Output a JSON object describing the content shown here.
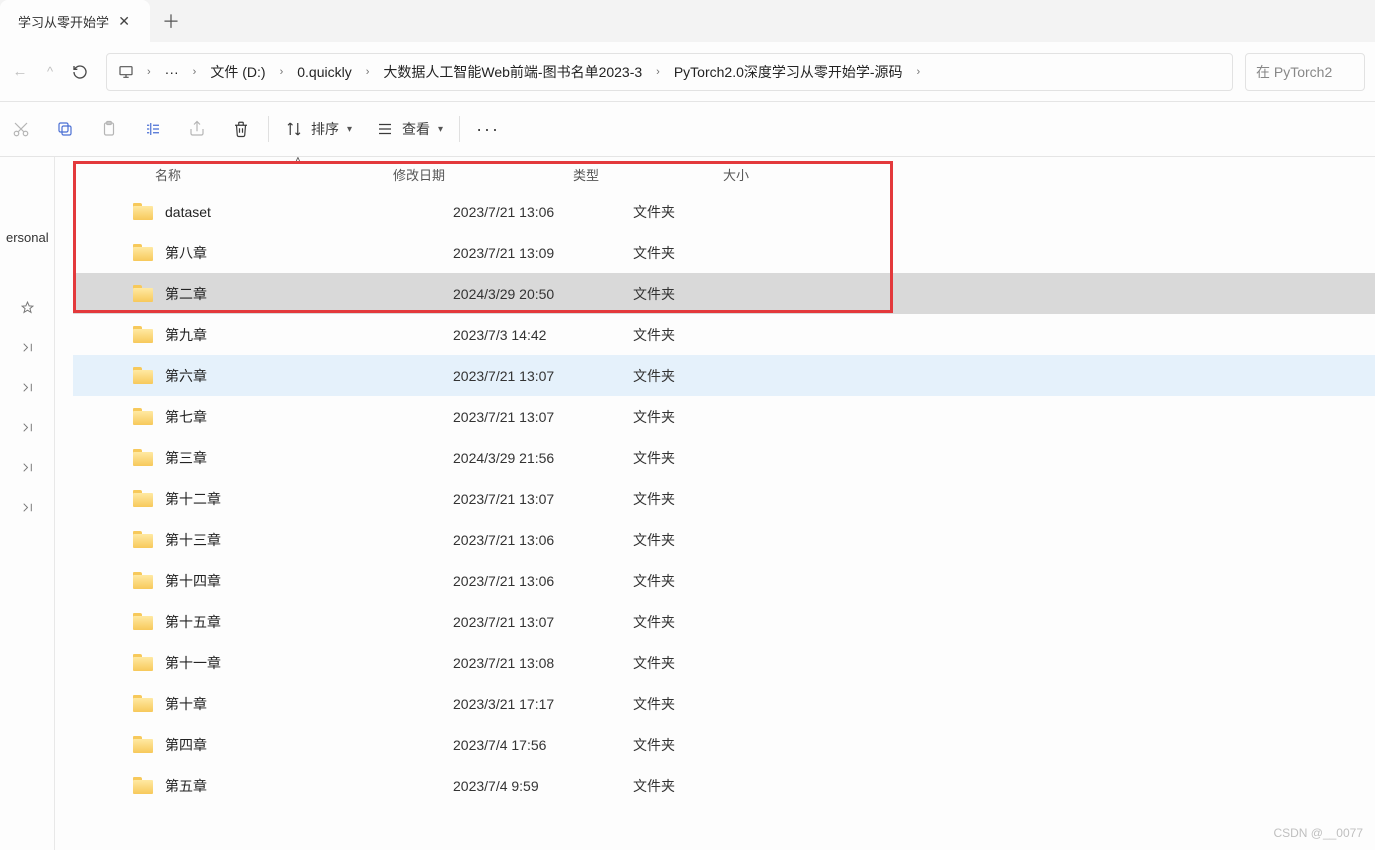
{
  "tab": {
    "title": "学习从零开始学"
  },
  "breadcrumb": {
    "items": [
      "文件 (D:)",
      "0.quickly",
      "大数据人工智能Web前端-图书名单2023-3",
      "PyTorch2.0深度学习从零开始学-源码"
    ],
    "ellipsis": "···"
  },
  "search": {
    "placeholder": "在 PyTorch2"
  },
  "toolbar": {
    "sort": "排序",
    "view": "查看"
  },
  "sidebar": {
    "personal": "ersonal"
  },
  "columns": {
    "name": "名称",
    "date": "修改日期",
    "type": "类型",
    "size": "大小"
  },
  "files": [
    {
      "name": "dataset",
      "date": "2023/7/21 13:06",
      "type": "文件夹",
      "state": ""
    },
    {
      "name": "第八章",
      "date": "2023/7/21 13:09",
      "type": "文件夹",
      "state": ""
    },
    {
      "name": "第二章",
      "date": "2024/3/29 20:50",
      "type": "文件夹",
      "state": "selected-grey"
    },
    {
      "name": "第九章",
      "date": "2023/7/3 14:42",
      "type": "文件夹",
      "state": ""
    },
    {
      "name": "第六章",
      "date": "2023/7/21 13:07",
      "type": "文件夹",
      "state": "hover-blue"
    },
    {
      "name": "第七章",
      "date": "2023/7/21 13:07",
      "type": "文件夹",
      "state": ""
    },
    {
      "name": "第三章",
      "date": "2024/3/29 21:56",
      "type": "文件夹",
      "state": ""
    },
    {
      "name": "第十二章",
      "date": "2023/7/21 13:07",
      "type": "文件夹",
      "state": ""
    },
    {
      "name": "第十三章",
      "date": "2023/7/21 13:06",
      "type": "文件夹",
      "state": ""
    },
    {
      "name": "第十四章",
      "date": "2023/7/21 13:06",
      "type": "文件夹",
      "state": ""
    },
    {
      "name": "第十五章",
      "date": "2023/7/21 13:07",
      "type": "文件夹",
      "state": ""
    },
    {
      "name": "第十一章",
      "date": "2023/7/21 13:08",
      "type": "文件夹",
      "state": ""
    },
    {
      "name": "第十章",
      "date": "2023/3/21 17:17",
      "type": "文件夹",
      "state": ""
    },
    {
      "name": "第四章",
      "date": "2023/7/4 17:56",
      "type": "文件夹",
      "state": ""
    },
    {
      "name": "第五章",
      "date": "2023/7/4 9:59",
      "type": "文件夹",
      "state": ""
    }
  ],
  "watermark": "CSDN @__0077"
}
